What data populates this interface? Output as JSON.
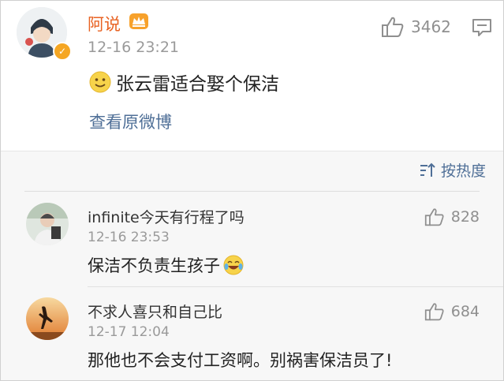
{
  "main_post": {
    "username": "阿说",
    "time": "12-16 23:21",
    "likes": "3462",
    "text": "张云雷适合娶个保洁",
    "view_original": "查看原微博"
  },
  "sort": {
    "label": "按热度"
  },
  "comments": [
    {
      "name": "infinite今天有行程了吗",
      "time": "12-16 23:53",
      "likes": "828",
      "text": "保洁不负责生孩子"
    },
    {
      "name": "不求人喜只和自己比",
      "time": "12-17 12:04",
      "likes": "684",
      "text": "那他也不会支付工资啊。别祸害保洁员了!"
    }
  ],
  "colors": {
    "username": "#e86222",
    "link": "#4f6f97",
    "verified": "#f5a623"
  },
  "icons": [
    "crown-icon",
    "verified-icon",
    "thumbs-up-icon",
    "comment-icon",
    "smile-emoji",
    "sort-icon",
    "laugh-cry-emoji"
  ]
}
